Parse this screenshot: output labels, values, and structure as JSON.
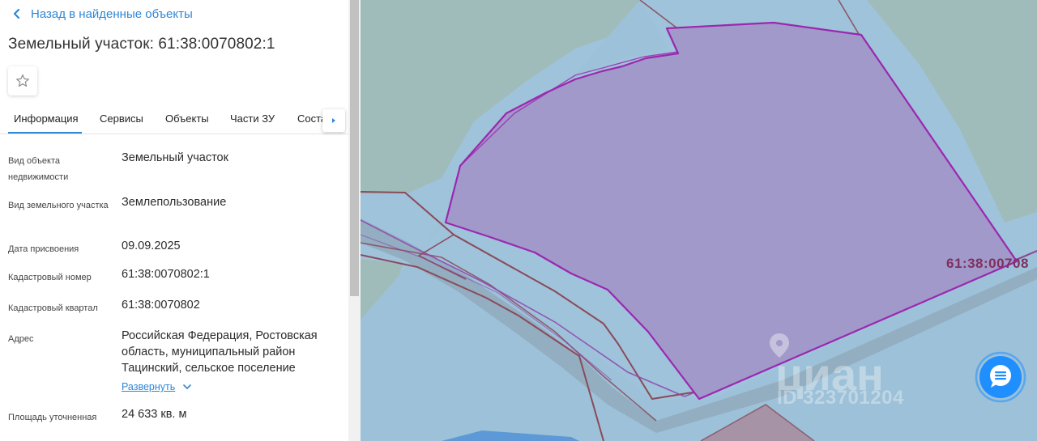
{
  "panel": {
    "back_label": "Назад в найденные объекты",
    "title": "Земельный участок: 61:38:0070802:1",
    "tabs": [
      {
        "label": "Информация",
        "active": true
      },
      {
        "label": "Сервисы"
      },
      {
        "label": "Объекты"
      },
      {
        "label": "Части ЗУ"
      },
      {
        "label": "Соста"
      }
    ],
    "fields": [
      {
        "label": "Вид объекта недвижимости",
        "value": "Земельный участок"
      },
      {
        "label": "Вид земельного участка",
        "value": "Землепользование"
      },
      {
        "label": "Дата присвоения",
        "value": "09.09.2025"
      },
      {
        "label": "Кадастровый номер",
        "value": "61:38:0070802:1"
      },
      {
        "label": "Кадастровый квартал",
        "value": "61:38:0070802"
      },
      {
        "label": "Адрес",
        "value": "Российская Федерация, Ростовская область, муниципальный район Тацинский, сельское поселение"
      },
      {
        "label": "Площадь уточненная",
        "value": "24 633 кв. м"
      }
    ],
    "expand_label": "Развернуть"
  },
  "map": {
    "parcel_label": "61:38:00708",
    "watermark_name": "циан",
    "watermark_id": "ID 323701204",
    "colors": {
      "water": "#9fc3da",
      "green_area": "#9fbcb9",
      "parcel_fill": "#a099c9",
      "parcel_stroke": "#9c27b0",
      "boundary_stroke": "#8a4a5a",
      "accent": "#2f86d6",
      "chat_button": "#1f8fff"
    }
  },
  "icons": {
    "back": "chevron-left-icon",
    "favorite": "star-outline-icon",
    "tabs_next": "caret-right-icon",
    "expand": "chevron-down-icon",
    "chat": "chat-bubble-icon"
  }
}
